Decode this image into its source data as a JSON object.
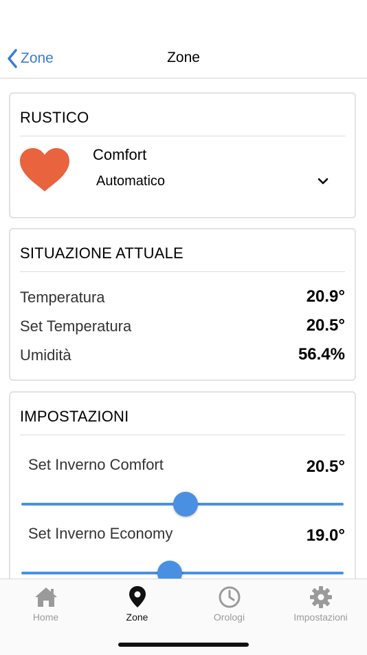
{
  "nav": {
    "back_label": "Zone",
    "title": "Zone"
  },
  "zone_card": {
    "title": "RUSTICO",
    "mode": "Comfort",
    "select_value": "Automatico",
    "heart_color": "#e8633e"
  },
  "current_card": {
    "title": "SITUAZIONE ATTUALE",
    "rows": [
      {
        "label": "Temperatura",
        "value": "20.9°"
      },
      {
        "label": "Set Temperatura",
        "value": "20.5°"
      },
      {
        "label": "Umidità",
        "value": "56.4%"
      }
    ]
  },
  "settings_card": {
    "title": "IMPOSTAZIONI",
    "settings": [
      {
        "label": "Set Inverno Comfort",
        "value": "20.5°",
        "slider_fraction": 0.51
      },
      {
        "label": "Set Inverno Economy",
        "value": "19.0°",
        "slider_fraction": 0.46
      }
    ]
  },
  "tabbar": {
    "tabs": [
      {
        "label": "Home",
        "icon": "home-icon",
        "active": false
      },
      {
        "label": "Zone",
        "icon": "location-pin-icon",
        "active": true
      },
      {
        "label": "Orologi",
        "icon": "clock-icon",
        "active": false
      },
      {
        "label": "Impostazioni",
        "icon": "gear-icon",
        "active": false
      }
    ]
  },
  "colors": {
    "accent": "#4a90e2",
    "link": "#3a7bd5",
    "inactive_tab": "#9a9a9a"
  }
}
